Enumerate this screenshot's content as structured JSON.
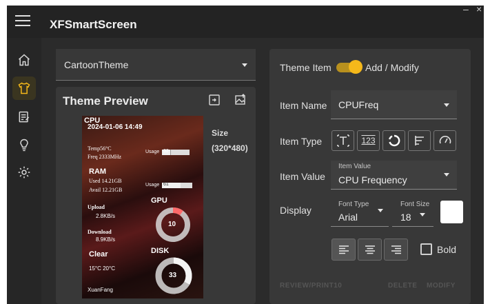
{
  "window": {
    "title": "XFSmartScreen",
    "minimize_glyph": "–",
    "close_glyph": "×"
  },
  "rail": {
    "items": [
      "home-icon",
      "theme-icon",
      "edit-list-icon",
      "lightbulb-icon",
      "settings-icon"
    ],
    "active": "theme-icon"
  },
  "theme_selector": {
    "value": "CartoonTheme"
  },
  "preview": {
    "title": "Theme Preview",
    "size_label": "Size",
    "size_value": "(320*480)",
    "screen": {
      "cpu_label": "CPU",
      "datetime": "2024-01-06  14:49",
      "temp": "Temp56°C",
      "freq": "Freq 2333MHz",
      "cpu_usage_label": "Usage",
      "cpu_usage_value": "32",
      "cpu_usage_pct": 0.32,
      "ram_label": "RAM",
      "ram_used": "Used 14.21GB",
      "ram_avail": "Avail 12.21GB",
      "ram_usage_label": "Usage",
      "ram_usage_value": "61",
      "ram_usage_pct": 0.61,
      "gpu_label": "GPU",
      "gpu_value": "10",
      "gpu_pct": 0.1,
      "upload_label": "Upload",
      "upload_value": "2.8KB/s",
      "download_label": "Download",
      "download_value": "8.9KB/s",
      "disk_label": "DISK",
      "disk_value": "33",
      "disk_pct": 0.33,
      "weather_label": "Clear",
      "weather_temps": "15°C  20°C",
      "city": "XuanFang"
    }
  },
  "editor": {
    "theme_item_label": "Theme Item",
    "mode_label": "Add / Modify",
    "toggle_on": true,
    "item_name_label": "Item Name",
    "item_name_value": "CPUFreq",
    "item_type_label": "Item Type",
    "item_types": [
      "text-type-icon",
      "number-type-icon",
      "circle-progress-icon",
      "bar-progress-icon",
      "gauge-icon"
    ],
    "item_type_number_glyph": "123",
    "item_value_label": "Item Value",
    "item_value_hint": "Item Value",
    "item_value_value": "CPU Frequency",
    "display_label": "Display",
    "font_type_hint": "Font Type",
    "font_type_value": "Arial",
    "font_size_hint": "Font Size",
    "font_size_value": "18",
    "font_color": "#ffffff",
    "alignments": [
      "align-left-icon",
      "align-center-icon",
      "align-right-icon"
    ],
    "bold_label": "Bold",
    "bold_checked": false,
    "footer_buttons": {
      "review": "REVIEW/PRINT10",
      "delete": "DELETE",
      "modify": "MODIFY"
    }
  },
  "colors": {
    "accent": "#f5b81a",
    "background": "#2b2b2b",
    "card": "#383838",
    "titlebar": "#232323"
  }
}
